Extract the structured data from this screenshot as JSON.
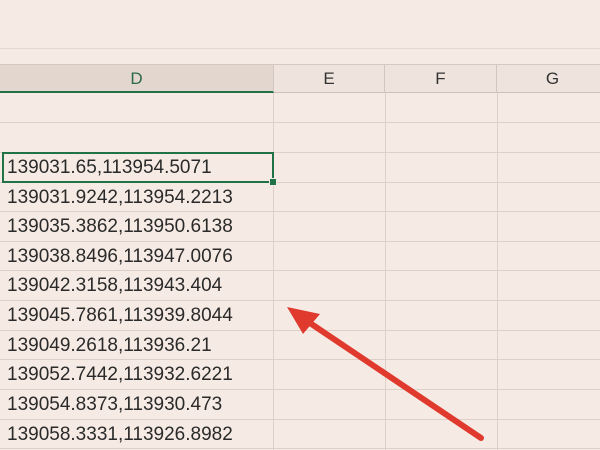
{
  "columns": {
    "d": "D",
    "e": "E",
    "f": "F",
    "g": "G"
  },
  "cells": {
    "d3": "139031.65,113954.5071",
    "d4": "139031.9242,113954.2213",
    "d5": "139035.3862,113950.6138",
    "d6": "139038.8496,113947.0076",
    "d7": "139042.3158,113943.404",
    "d8": "139045.7861,113939.8044",
    "d9": "139049.2618,113936.21",
    "d10": "139052.7442,113932.6221",
    "d11": "139054.8373,113930.473",
    "d12": "139058.3331,113926.8982"
  },
  "colors": {
    "background": "#f6ebe4",
    "selection": "#217346",
    "arrow": "#e03a2f"
  },
  "annotation_icon": "red-arrow-icon"
}
